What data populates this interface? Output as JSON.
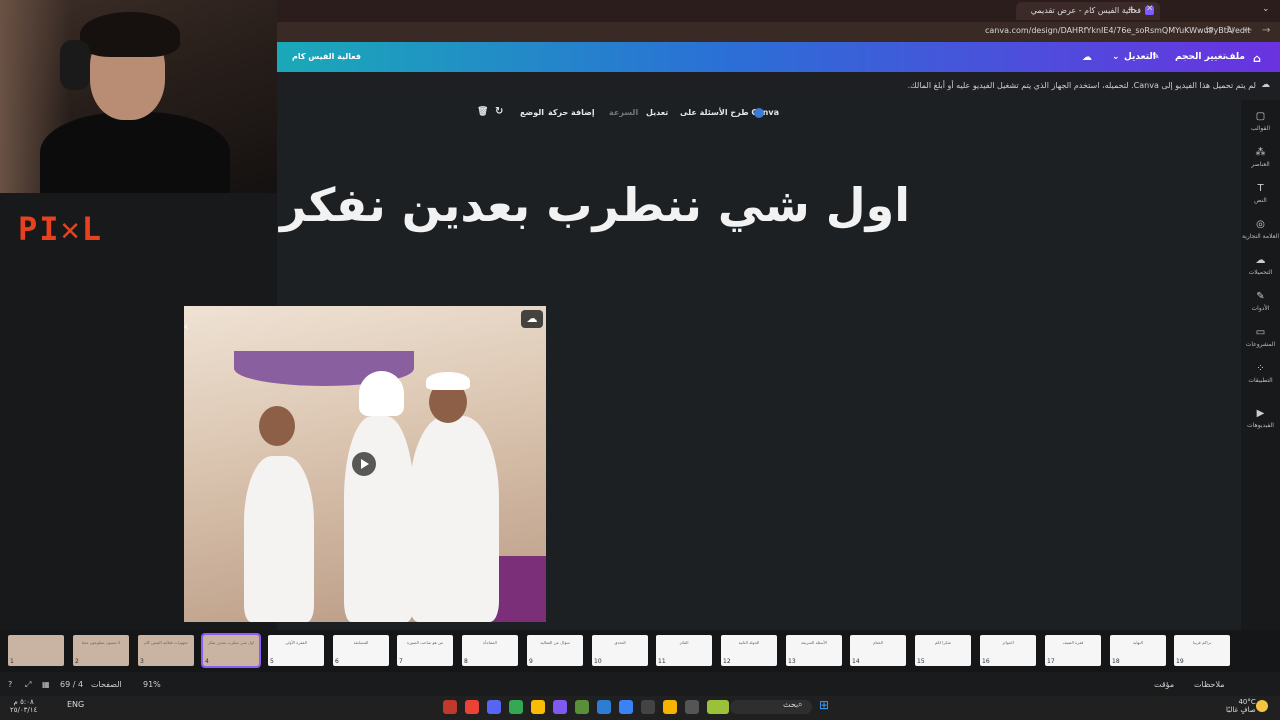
{
  "browser": {
    "tab_title": "فعالية الفيس كام - عرض تقديمي",
    "url": "canva.com/design/DAHRfYknIE4/76e_soRsmQMYuKWwuPyBtA/edit",
    "new_tab": "+",
    "close": "✕",
    "menu": "⌄",
    "back": "←",
    "forward": "→",
    "reload": "↻",
    "tune": "⇆"
  },
  "overlay": {
    "logo_text": "PI✕L"
  },
  "header": {
    "home_icon": "⌂",
    "file": "ملف",
    "resize": "تغيير الحجم",
    "edit": "التعديل",
    "edit_chevron": "⌄",
    "pencil": "✎",
    "cloud": "☁",
    "design_title": "فعالية الفيس كام"
  },
  "notice": {
    "text": "لم يتم تحميل هذا الفيديو إلى Canva. لتحميله، استخدم الجهاز الذي يتم تشغيل الفيديو عليه أو أبلغ المالك.",
    "icon": "☁"
  },
  "toolbar": {
    "ask_canva": "طرح الأسئلة على Canva",
    "edit": "تعديل",
    "speed": "السرعة",
    "add_animation": "إضافة حركة",
    "position": "الوضع",
    "loop_icon": "↻",
    "trash_icon": "🗑"
  },
  "slide": {
    "title": "اول شي ننطرب  بعدين نفكر",
    "play_icon": "▶",
    "cloud_icon": "☁",
    "arrow_icon": "‹"
  },
  "sidebar": {
    "items": [
      {
        "icon": "▢",
        "label": "القوالب"
      },
      {
        "icon": "⁂",
        "label": "العناصر"
      },
      {
        "icon": "T",
        "label": "النص"
      },
      {
        "icon": "◎",
        "label": "العلامة التجارية"
      },
      {
        "icon": "☁",
        "label": "التحميلات"
      },
      {
        "icon": "✎",
        "label": "الأدوات"
      },
      {
        "icon": "▭",
        "label": "المشروعات"
      },
      {
        "icon": "⁘",
        "label": "التطبيقات"
      },
      {
        "icon": "▶",
        "label": "الفيديوهات"
      }
    ]
  },
  "thumbnails": [
    {
      "num": "1",
      "caption": "",
      "kind": "img"
    },
    {
      "num": "2",
      "caption": "لا تنسون تتطوعون معنا",
      "kind": "img"
    },
    {
      "num": "3",
      "caption": "تجهيزات فعالية الفيس كام",
      "kind": "img"
    },
    {
      "num": "4",
      "caption": "اول شي ننطرب بعدين نفكر",
      "kind": "img"
    },
    {
      "num": "5",
      "caption": "الفقرة الأولى",
      "kind": "plain"
    },
    {
      "num": "6",
      "caption": "المسابقة",
      "kind": "plain"
    },
    {
      "num": "7",
      "caption": "من هو صاحب الصورة",
      "kind": "plain"
    },
    {
      "num": "8",
      "caption": "المفاجأة",
      "kind": "plain"
    },
    {
      "num": "9",
      "caption": "سؤال عن الفعالية",
      "kind": "plain"
    },
    {
      "num": "10",
      "caption": "التحدي",
      "kind": "plain"
    },
    {
      "num": "11",
      "caption": "الفائز",
      "kind": "plain"
    },
    {
      "num": "12",
      "caption": "الجولة الثانية",
      "kind": "plain"
    },
    {
      "num": "13",
      "caption": "الأسئلة السريعة",
      "kind": "plain"
    },
    {
      "num": "14",
      "caption": "الختام",
      "kind": "plain"
    },
    {
      "num": "15",
      "caption": "شكرا لكم",
      "kind": "plain"
    },
    {
      "num": "16",
      "caption": "الجوائز",
      "kind": "plain"
    },
    {
      "num": "17",
      "caption": "فقرة الضيف",
      "kind": "plain"
    },
    {
      "num": "18",
      "caption": "النهاية",
      "kind": "plain"
    },
    {
      "num": "19",
      "caption": "نراكم قريبا",
      "kind": "plain"
    }
  ],
  "bottom_bar": {
    "notes": "ملاحظات",
    "timer": "مؤقت",
    "pages_label": "الصفحات",
    "page_count": "69 / 4",
    "zoom": "91%",
    "help": "?",
    "fullscreen": "⤢",
    "grid": "▦"
  },
  "taskbar": {
    "search_placeholder": "بحث",
    "lang": "ENG",
    "time": "٥:٠٨ م",
    "date": "٢٥/٠٣/١٤",
    "weather_temp": "40°C",
    "weather_desc": "صافٍ غالبًا",
    "windows_icon": "⊞"
  }
}
